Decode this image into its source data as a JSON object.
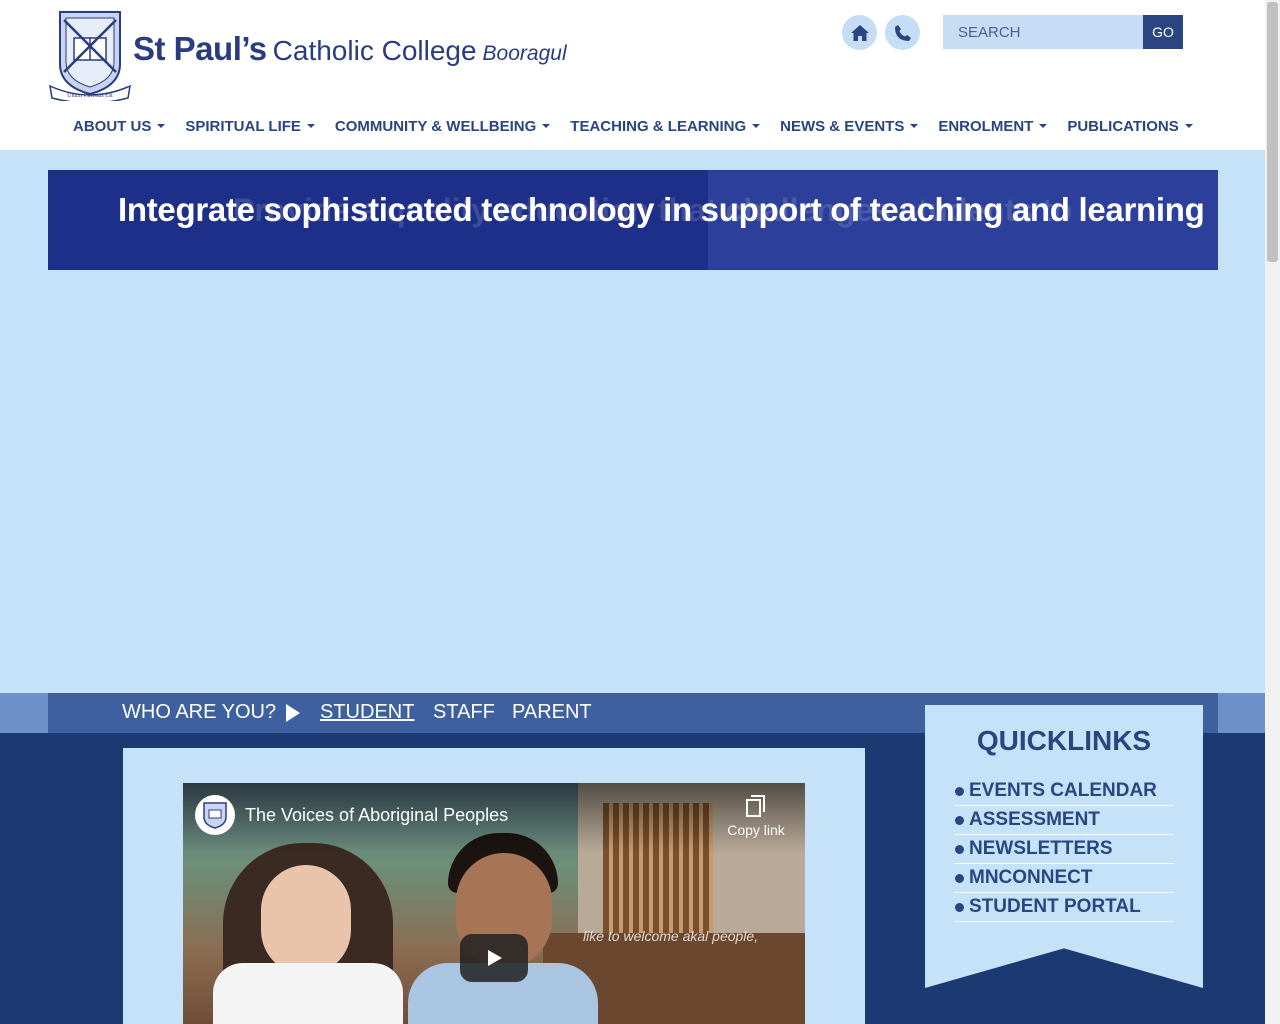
{
  "header": {
    "brand_main": "St Paul’s",
    "brand_sub": "Catholic College",
    "brand_location": "Booragul",
    "crest_motto": "Unum Christus Est",
    "search_placeholder": "SEARCH",
    "go_label": "GO",
    "home_icon": "home-icon",
    "phone_icon": "phone-icon"
  },
  "nav": {
    "items": [
      {
        "label": "ABOUT US"
      },
      {
        "label": "SPIRITUAL LIFE"
      },
      {
        "label": "COMMUNITY & WELLBEING"
      },
      {
        "label": "TEACHING & LEARNING"
      },
      {
        "label": "NEWS & EVENTS"
      },
      {
        "label": "ENROLMENT"
      },
      {
        "label": "PUBLICATIONS"
      }
    ]
  },
  "banner": {
    "text": "Integrate sophisticated technology in support of teaching and learning",
    "ghost_text": "Provide a quality education that challenges students to"
  },
  "who": {
    "label": "WHO ARE YOU?",
    "options": [
      "STUDENT",
      "STAFF",
      "PARENT"
    ],
    "selected": "STUDENT"
  },
  "video": {
    "title": "The Voices of Aboriginal Peoples",
    "copy_link": "Copy link",
    "overlay_text": "like to welcome  akal people,"
  },
  "quicklinks": {
    "title": "QUICKLINKS",
    "items": [
      {
        "label": "EVENTS CALENDAR"
      },
      {
        "label": "ASSESSMENT"
      },
      {
        "label": "NEWSLETTERS"
      },
      {
        "label": "MNCONNECT"
      },
      {
        "label": "STUDENT PORTAL"
      }
    ]
  },
  "colors": {
    "brand_navy": "#2a4580",
    "light_blue": "#c6e2f8",
    "banner_blue": "#1e2f8a",
    "dark_band": "#1c3a71"
  }
}
